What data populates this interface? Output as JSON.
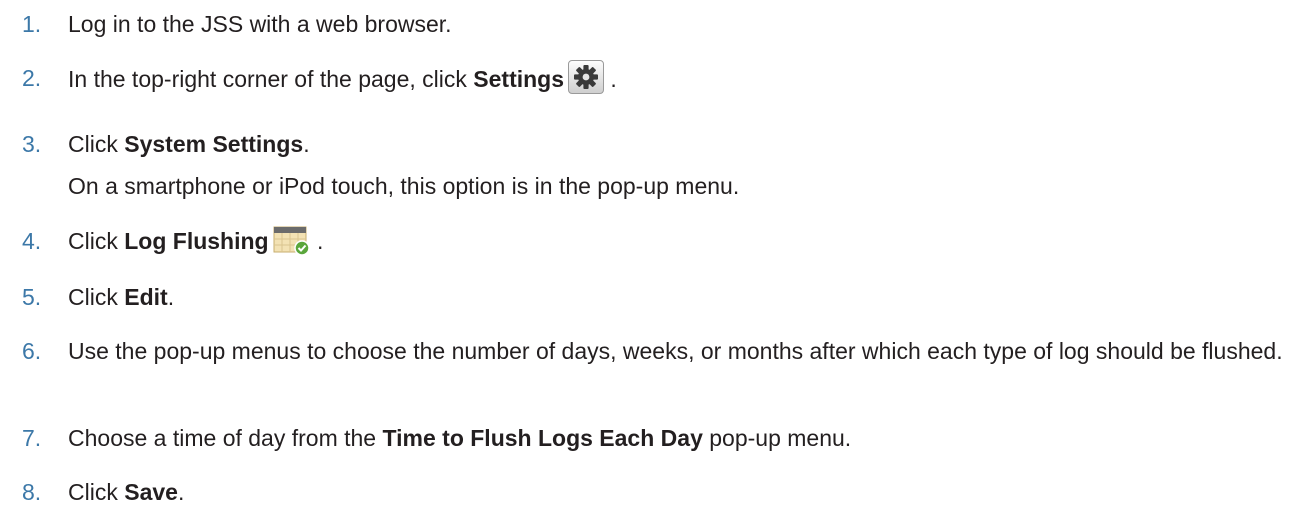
{
  "steps": [
    {
      "num": "1.",
      "parts": {
        "a": "Log in to the JSS with a web browser."
      }
    },
    {
      "num": "2.",
      "parts": {
        "a": "In the top-right corner of the page, click ",
        "b": "Settings",
        "c": " ."
      }
    },
    {
      "num": "3.",
      "parts": {
        "a": "Click ",
        "b": "System Settings",
        "c": "."
      },
      "note": "On a smartphone or iPod touch, this option is in the pop-up menu."
    },
    {
      "num": "4.",
      "parts": {
        "a": "Click ",
        "b": "Log Flushing",
        "c": " ."
      }
    },
    {
      "num": "5.",
      "parts": {
        "a": "Click ",
        "b": "Edit",
        "c": "."
      }
    },
    {
      "num": "6.",
      "parts": {
        "a": "Use the pop-up menus to choose the number of days, weeks, or months after which each type of log should be flushed."
      }
    },
    {
      "num": "7.",
      "parts": {
        "a": "Choose a time of day from the ",
        "b": "Time to Flush Logs Each Day",
        "c": " pop-up menu."
      }
    },
    {
      "num": "8.",
      "parts": {
        "a": "Click ",
        "b": "Save",
        "c": "."
      }
    }
  ],
  "icons": {
    "settings": "gear-icon",
    "log_flushing": "calendar-check-icon"
  },
  "colors": {
    "step_number": "#3c78a8",
    "text": "#231f20"
  }
}
